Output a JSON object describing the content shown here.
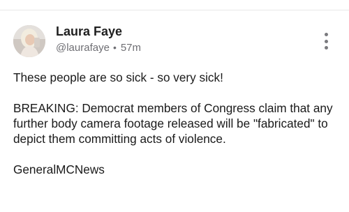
{
  "post": {
    "author": {
      "display_name": "Laura Faye",
      "handle": "@laurafaye",
      "separator": "•",
      "time_ago": "57m",
      "avatar_icon": "profile-photo"
    },
    "more_icon": "vertical-ellipsis-icon",
    "paragraphs": [
      "These people are so sick - so very sick!",
      "BREAKING: Democrat members of Congress claim that any further body camera footage released will be \"fabricated\" to depict them committing acts of violence.",
      "GeneralMCNews"
    ]
  },
  "colors": {
    "text_primary": "#1a1a1a",
    "text_secondary": "#6e6e73",
    "divider": "#e8e8e8",
    "background": "#ffffff"
  }
}
